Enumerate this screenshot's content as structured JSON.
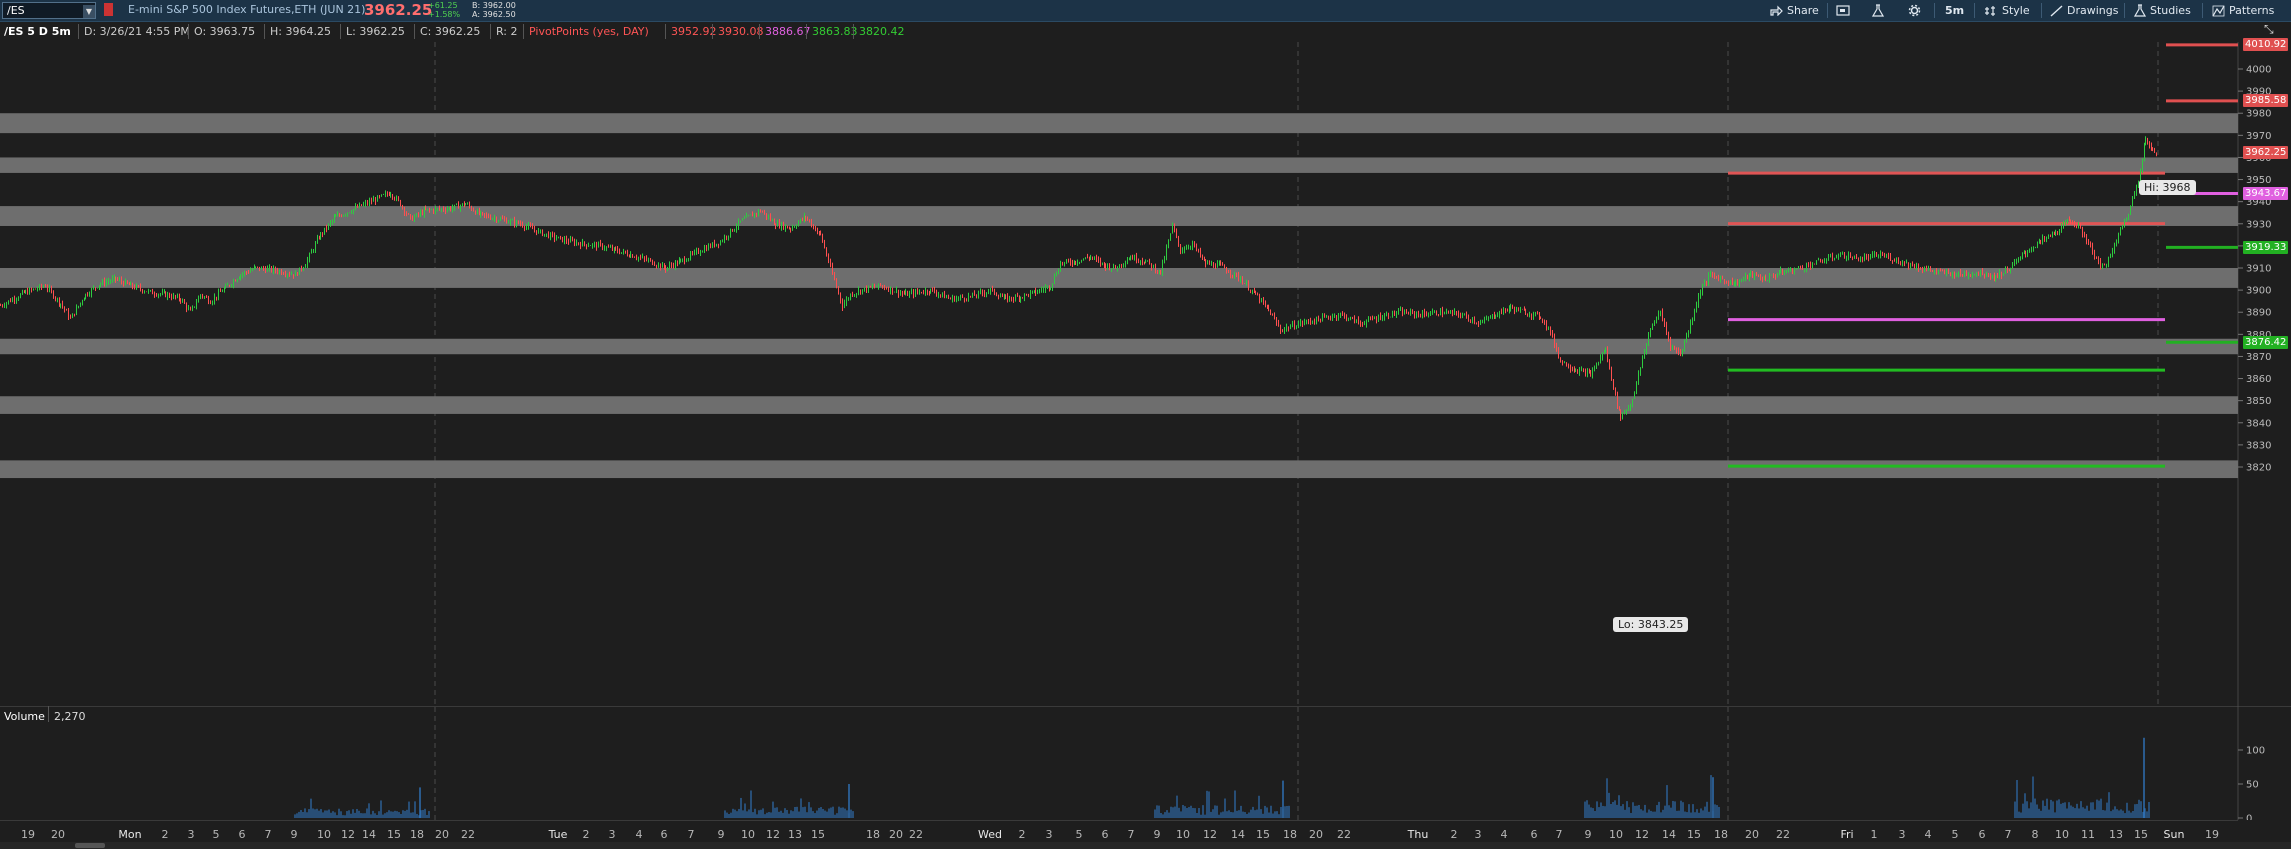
{
  "toolbar": {
    "symbol": "/ES",
    "instrument": "E-mini S&P 500 Index Futures,ETH (JUN 21)",
    "last_price": "3962.25",
    "net_change": "+61.25",
    "pct_change": "+1.58%",
    "bid": "B: 3962.00",
    "ask": "A: 3962.50",
    "share": "Share",
    "timeframe": "5m",
    "style": "Style",
    "drawings": "Drawings",
    "studies": "Studies",
    "patterns": "Patterns"
  },
  "infobar": {
    "title": "/ES 5 D 5m",
    "date": "D: 3/26/21 4:55 PM",
    "open": "O: 3963.75",
    "high": "H: 3964.25",
    "low": "L: 3962.25",
    "close": "C: 3962.25",
    "range": "R: 2",
    "pivot_label": "PivotPoints (yes, DAY)",
    "pivot_values": [
      "3952.92",
      "3930.08",
      "3886.67",
      "3863.83",
      "3820.42"
    ]
  },
  "price_axis": {
    "ticks": [
      "4000",
      "3990",
      "3980",
      "3970",
      "3960",
      "3950",
      "3940",
      "3930",
      "3920",
      "3910",
      "3900",
      "3890",
      "3880",
      "3870",
      "3860",
      "3850",
      "3840",
      "3830",
      "3820"
    ],
    "tags": [
      {
        "label": "4010.92",
        "color": "#e05050"
      },
      {
        "label": "3985.58",
        "color": "#e05050"
      },
      {
        "label": "3962.25",
        "color": "#e05050"
      },
      {
        "label": "3943.67",
        "color": "#e060e0"
      },
      {
        "label": "3919.33",
        "color": "#22b022"
      },
      {
        "label": "3876.42",
        "color": "#22b022"
      }
    ]
  },
  "annotations": {
    "high": "Hi: 3968",
    "low": "Lo: 3843.25"
  },
  "volume": {
    "label": "Volume",
    "value": "2,270",
    "ticks": [
      "100",
      "50",
      "0"
    ]
  },
  "time_axis": [
    "19",
    "20",
    "Mon",
    "2",
    "3",
    "5",
    "6",
    "7",
    "9",
    "10",
    "12",
    "14",
    "15",
    "18",
    "20",
    "22",
    "Tue",
    "2",
    "3",
    "4",
    "6",
    "7",
    "9",
    "10",
    "12",
    "13",
    "15",
    "18",
    "20",
    "22",
    "Wed",
    "2",
    "3",
    "5",
    "6",
    "7",
    "9",
    "10",
    "12",
    "14",
    "15",
    "18",
    "20",
    "22",
    "Thu",
    "2",
    "3",
    "4",
    "6",
    "7",
    "9",
    "10",
    "12",
    "14",
    "15",
    "18",
    "20",
    "22",
    "Fri",
    "1",
    "3",
    "4",
    "5",
    "6",
    "7",
    "8",
    "10",
    "11",
    "13",
    "15",
    "Sun",
    "19"
  ],
  "zones": [
    {
      "low": 3971,
      "high": 3980
    },
    {
      "low": 3953,
      "high": 3960
    },
    {
      "low": 3929,
      "high": 3938
    },
    {
      "low": 3901,
      "high": 3910
    },
    {
      "low": 3871,
      "high": 3878
    },
    {
      "low": 3844,
      "high": 3852
    },
    {
      "low": 3815,
      "high": 3823
    }
  ],
  "pivot_lines": [
    {
      "value": 3952.92,
      "color": "#e05555"
    },
    {
      "value": 3930.08,
      "color": "#e05555"
    },
    {
      "value": 3886.67,
      "color": "#e060e0"
    },
    {
      "value": 3863.83,
      "color": "#22bb22"
    },
    {
      "value": 3820.42,
      "color": "#22bb22"
    }
  ],
  "future_pivot_lines": [
    {
      "value": 4010.92,
      "color": "#e05050"
    },
    {
      "value": 3985.58,
      "color": "#e05050"
    },
    {
      "value": 3943.67,
      "color": "#e060e0"
    },
    {
      "value": 3919.33,
      "color": "#22b022"
    },
    {
      "value": 3876.42,
      "color": "#22b022"
    }
  ],
  "price_path": [
    [
      0,
      3893
    ],
    [
      25,
      3899
    ],
    [
      45,
      3902
    ],
    [
      60,
      3894
    ],
    [
      70,
      3887
    ],
    [
      85,
      3898
    ],
    [
      100,
      3903
    ],
    [
      115,
      3905
    ],
    [
      130,
      3902
    ],
    [
      150,
      3899
    ],
    [
      165,
      3898
    ],
    [
      180,
      3896
    ],
    [
      190,
      3890
    ],
    [
      200,
      3898
    ],
    [
      210,
      3895
    ],
    [
      225,
      3901
    ],
    [
      240,
      3907
    ],
    [
      255,
      3910
    ],
    [
      275,
      3909
    ],
    [
      295,
      3907
    ],
    [
      305,
      3912
    ],
    [
      320,
      3925
    ],
    [
      335,
      3933
    ],
    [
      355,
      3937
    ],
    [
      375,
      3941
    ],
    [
      390,
      3944
    ],
    [
      400,
      3939
    ],
    [
      410,
      3932
    ],
    [
      425,
      3936
    ],
    [
      450,
      3937
    ],
    [
      465,
      3939
    ],
    [
      480,
      3934
    ],
    [
      500,
      3932
    ],
    [
      520,
      3930
    ],
    [
      540,
      3926
    ],
    [
      560,
      3923
    ],
    [
      580,
      3921
    ],
    [
      600,
      3920
    ],
    [
      615,
      3918
    ],
    [
      630,
      3916
    ],
    [
      650,
      3913
    ],
    [
      665,
      3910
    ],
    [
      680,
      3913
    ],
    [
      700,
      3918
    ],
    [
      720,
      3922
    ],
    [
      740,
      3931
    ],
    [
      760,
      3936
    ],
    [
      775,
      3930
    ],
    [
      790,
      3928
    ],
    [
      805,
      3933
    ],
    [
      820,
      3925
    ],
    [
      830,
      3910
    ],
    [
      842,
      3893
    ],
    [
      850,
      3898
    ],
    [
      860,
      3900
    ],
    [
      880,
      3902
    ],
    [
      905,
      3898
    ],
    [
      930,
      3900
    ],
    [
      950,
      3896
    ],
    [
      970,
      3897
    ],
    [
      990,
      3900
    ],
    [
      1005,
      3896
    ],
    [
      1020,
      3897
    ],
    [
      1035,
      3899
    ],
    [
      1050,
      3902
    ],
    [
      1060,
      3912
    ],
    [
      1075,
      3913
    ],
    [
      1090,
      3915
    ],
    [
      1105,
      3911
    ],
    [
      1115,
      3910
    ],
    [
      1130,
      3915
    ],
    [
      1145,
      3913
    ],
    [
      1160,
      3908
    ],
    [
      1172,
      3929
    ],
    [
      1180,
      3918
    ],
    [
      1192,
      3921
    ],
    [
      1205,
      3912
    ],
    [
      1220,
      3911
    ],
    [
      1240,
      3905
    ],
    [
      1255,
      3898
    ],
    [
      1268,
      3891
    ],
    [
      1280,
      3882
    ],
    [
      1300,
      3885
    ],
    [
      1320,
      3887
    ],
    [
      1340,
      3889
    ],
    [
      1360,
      3885
    ],
    [
      1380,
      3888
    ],
    [
      1400,
      3890
    ],
    [
      1420,
      3889
    ],
    [
      1440,
      3890
    ],
    [
      1460,
      3889
    ],
    [
      1480,
      3885
    ],
    [
      1495,
      3889
    ],
    [
      1510,
      3892
    ],
    [
      1525,
      3890
    ],
    [
      1540,
      3888
    ],
    [
      1550,
      3881
    ],
    [
      1560,
      3868
    ],
    [
      1575,
      3864
    ],
    [
      1590,
      3862
    ],
    [
      1605,
      3873
    ],
    [
      1615,
      3852
    ],
    [
      1620,
      3843
    ],
    [
      1630,
      3848
    ],
    [
      1640,
      3865
    ],
    [
      1650,
      3883
    ],
    [
      1660,
      3890
    ],
    [
      1670,
      3875
    ],
    [
      1680,
      3871
    ],
    [
      1690,
      3885
    ],
    [
      1700,
      3900
    ],
    [
      1710,
      3907
    ],
    [
      1720,
      3905
    ],
    [
      1735,
      3903
    ],
    [
      1750,
      3907
    ],
    [
      1765,
      3905
    ],
    [
      1780,
      3908
    ],
    [
      1800,
      3910
    ],
    [
      1820,
      3913
    ],
    [
      1840,
      3916
    ],
    [
      1860,
      3914
    ],
    [
      1880,
      3916
    ],
    [
      1900,
      3913
    ],
    [
      1920,
      3910
    ],
    [
      1940,
      3908
    ],
    [
      1960,
      3907
    ],
    [
      1980,
      3908
    ],
    [
      1995,
      3906
    ],
    [
      2010,
      3910
    ],
    [
      2025,
      3917
    ],
    [
      2040,
      3922
    ],
    [
      2055,
      3926
    ],
    [
      2070,
      3932
    ],
    [
      2082,
      3926
    ],
    [
      2092,
      3918
    ],
    [
      2100,
      3910
    ],
    [
      2110,
      3915
    ],
    [
      2118,
      3925
    ],
    [
      2128,
      3935
    ],
    [
      2138,
      3950
    ],
    [
      2145,
      3968
    ],
    [
      2152,
      3963
    ],
    [
      2158,
      3962
    ]
  ]
}
